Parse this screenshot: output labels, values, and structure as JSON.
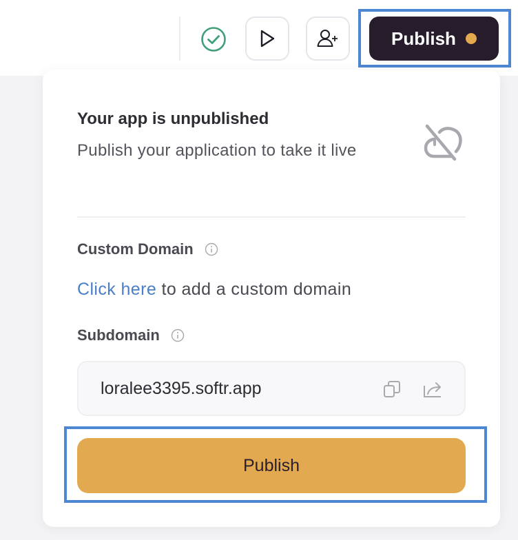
{
  "toolbar": {
    "status_icon": "check-circle-icon",
    "preview_icon": "play-icon",
    "invite_icon": "user-plus-icon",
    "publish_label": "Publish",
    "unpublished_dot_color": "#e2a94f"
  },
  "publish_panel": {
    "title": "Your app is unpublished",
    "description": "Publish your application to take it live",
    "status_icon": "cloud-off-icon",
    "custom_domain": {
      "label": "Custom Domain",
      "link_text": "Click here",
      "rest_text": " to add a custom domain"
    },
    "subdomain": {
      "label": "Subdomain",
      "value": "loralee3395.softr.app",
      "copy_icon": "copy-icon",
      "share_icon": "external-share-icon"
    },
    "publish_button_label": "Publish"
  },
  "colors": {
    "primary_dark": "#261c2c",
    "accent": "#e2a951",
    "link": "#4a7fc8",
    "success": "#3f9f7a",
    "highlight": "#4d86d1"
  }
}
